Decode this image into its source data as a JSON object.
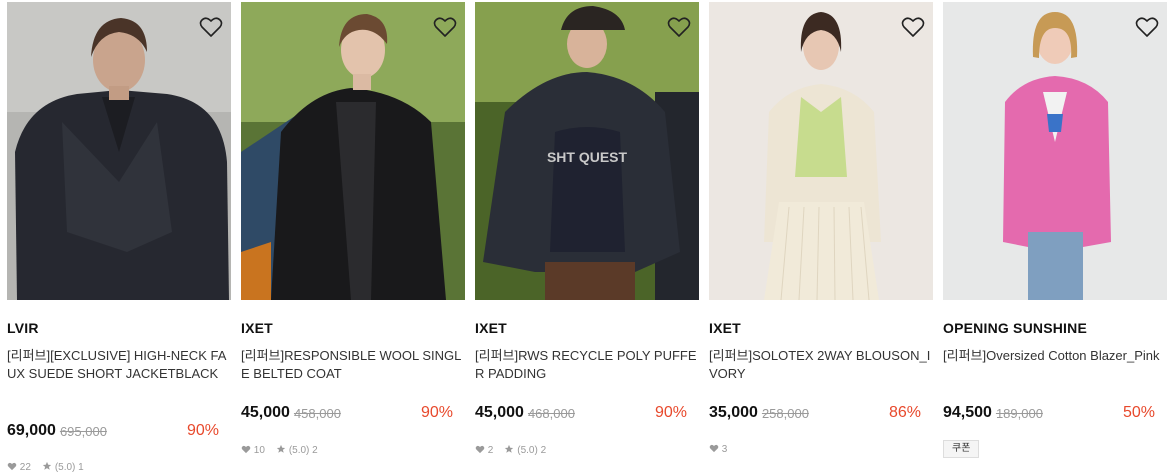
{
  "products": [
    {
      "brand": "LVIR",
      "name": "[리퍼브][EXCLUSIVE] HIGH-NECK FAUX SUEDE SHORT JACKETBLACK",
      "price": "69,000",
      "original_price": "695,000",
      "discount": "90%",
      "likes": "22",
      "rating": "(5.0) 1",
      "image_colors": {
        "bg": "#b9b9b6",
        "top": "#cfcfcc",
        "garment": "#2a2c33",
        "skin": "#c9a48d",
        "hair": "#4a3428"
      }
    },
    {
      "brand": "IXET",
      "name": "[리퍼브]RESPONSIBLE WOOL SINGLE BELTED COAT",
      "price": "45,000",
      "original_price": "458,000",
      "discount": "90%",
      "likes": "10",
      "rating": "(5.0) 2",
      "image_colors": {
        "bg": "#5f7a3a",
        "top": "#9bb364",
        "garment": "#1b1b1d",
        "skin": "#e3c3ac",
        "hair": "#6b4a32"
      }
    },
    {
      "brand": "IXET",
      "name": "[리퍼브]RWS RECYCLE POLY PUFFER PADDING",
      "price": "45,000",
      "original_price": "468,000",
      "discount": "90%",
      "likes": "2",
      "rating": "(5.0) 2",
      "image_colors": {
        "bg": "#4f6a2c",
        "top": "#8fa956",
        "garment": "#2b2f38",
        "skin": "#d8b39a",
        "hair": "#2a2522"
      }
    },
    {
      "brand": "IXET",
      "name": "[리퍼브]SOLOTEX 2WAY BLOUSON_IVORY",
      "price": "35,000",
      "original_price": "258,000",
      "discount": "86%",
      "likes": "3",
      "rating": "",
      "image_colors": {
        "bg": "#ebe6e1",
        "top": "#f1ede9",
        "garment": "#ece4d4",
        "skin": "#e7c7b3",
        "hair": "#3c2a22"
      }
    },
    {
      "brand": "OPENING SUNSHINE",
      "name": "[리퍼브]Oversized Cotton Blazer_Pink",
      "price": "94,500",
      "original_price": "189,000",
      "discount": "50%",
      "likes": "",
      "rating": "",
      "badge": "쿠폰",
      "image_colors": {
        "bg": "#e6e7e7",
        "top": "#eeefef",
        "garment": "#e569ad",
        "skin": "#efcbb8",
        "hair": "#c79a55"
      }
    }
  ],
  "icons": {
    "wishlist": "heart-outline-icon",
    "likes": "heart-icon",
    "rating": "star-icon"
  },
  "accent_color": "#e8492c"
}
